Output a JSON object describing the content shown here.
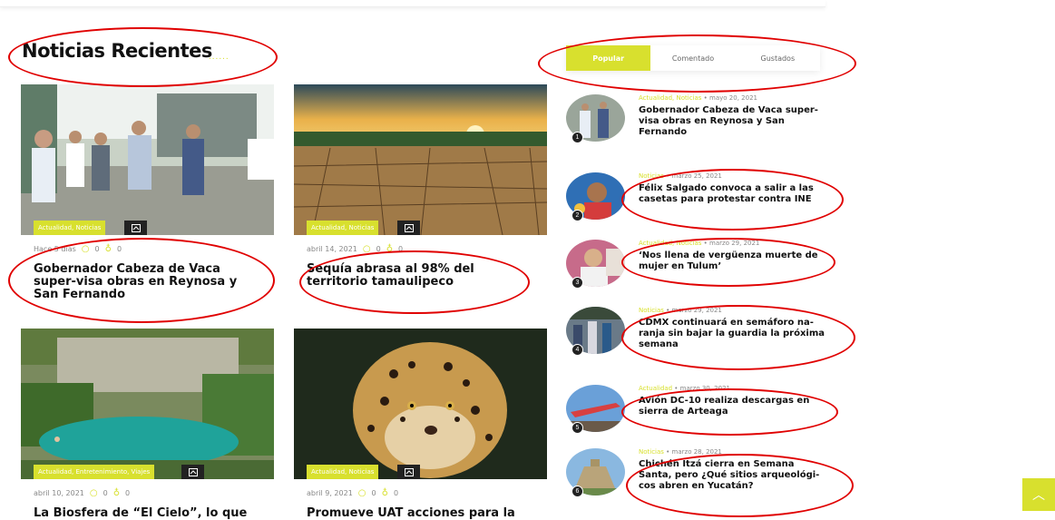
{
  "section": {
    "title": "Noticias Recientes",
    "dots": "......"
  },
  "tabs": [
    {
      "label": "Popular",
      "active": true
    },
    {
      "label": "Comentado",
      "active": false
    },
    {
      "label": "Gustados",
      "active": false
    }
  ],
  "cards": [
    {
      "category": "Actualidad, Noticias",
      "date": "Hace 5 días",
      "comments": "0",
      "likes": "0",
      "title": "Gobernador Cabeza de Vaca super-visa obras en Reynosa y San Fernando",
      "image": "people-walking"
    },
    {
      "category": "Actualidad, Noticias",
      "date": "abril 14, 2021",
      "comments": "0",
      "likes": "0",
      "title": "Sequía abrasa al 98% del territorio tamaulipeco",
      "image": "dry-land"
    },
    {
      "category": "Actualidad, Entretenimiento, Viajes",
      "date": "abril 10, 2021",
      "comments": "0",
      "likes": "0",
      "title": "La Biosfera de “El Cielo”, lo que de-",
      "image": "lagoon"
    },
    {
      "category": "Actualidad, Noticias",
      "date": "abril 9, 2021",
      "comments": "0",
      "likes": "0",
      "title": "Promueve UAT acciones para la con-",
      "image": "jaguar"
    }
  ],
  "popular": [
    {
      "num": "1",
      "category": "Actualidad, Noticias",
      "date": "mayo 20, 2021",
      "title": "Gobernador Cabeza de Vaca super-visa obras en Reynosa y San Fernando"
    },
    {
      "num": "2",
      "category": "Noticias",
      "date": "marzo 25, 2021",
      "title": "Félix Salgado convoca a salir a las casetas para protestar contra INE"
    },
    {
      "num": "3",
      "category": "Actualidad, Noticias",
      "date": "marzo 29, 2021",
      "title": "‘Nos llena de vergüenza muerte de mujer en Tulum’"
    },
    {
      "num": "4",
      "category": "Noticias",
      "date": "marzo 29, 2021",
      "title": "CDMX continuará en semáforo na-ranja sin bajar la guardia la próxima semana"
    },
    {
      "num": "5",
      "category": "Actualidad",
      "date": "marzo 30, 2021",
      "title": "Avión DC-10 realiza descargas en sierra de Arteaga"
    },
    {
      "num": "6",
      "category": "Noticias",
      "date": "marzo 28, 2021",
      "title": "Chichén Itzá cierra en Semana Santa, pero ¿Qué sitios arqueológi-cos abren en Yucatán?"
    }
  ],
  "scroll_top": {
    "icon": "chevron-up-icon"
  },
  "colors": {
    "accent": "#d8e02e",
    "annotation": "#e00000"
  }
}
